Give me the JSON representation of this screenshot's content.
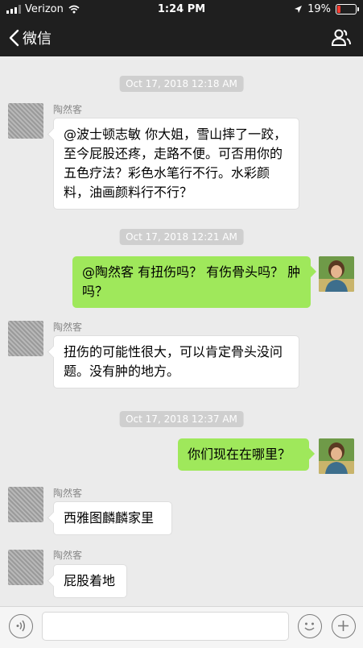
{
  "status": {
    "carrier": "Verizon",
    "time": "1:24 PM",
    "battery": "19%",
    "battery_level": 0.19
  },
  "nav": {
    "back_label": "微信"
  },
  "messages": {
    "ts1": "Oct 17, 2018 12:18 AM",
    "m1_name": "陶然客",
    "m1_text": "@波士顿志敏 你大姐，雪山摔了一跤，至今屁股还疼，走路不便。可否用你的五色疗法？彩色水笔行不行。水彩颜料，油画颜料行不行？",
    "ts2": "Oct 17, 2018 12:21 AM",
    "m2_text": "@陶然客 有扭伤吗？ 有伤骨头吗？ 肿吗？",
    "m3_name": "陶然客",
    "m3_text": "扭伤的可能性很大，可以肯定骨头没问题。没有肿的地方。",
    "ts3": "Oct 17, 2018 12:37 AM",
    "m4_text": "你们现在在哪里？",
    "m5_name": "陶然客",
    "m5_text": "西雅图麟麟家里",
    "m6_name": "陶然客",
    "m6_text": "屁股着地"
  },
  "icons": {
    "back": "chevron-left-icon",
    "contacts": "person-group-icon",
    "voice": "voice-icon",
    "emoji": "emoji-icon",
    "plus": "plus-icon"
  },
  "colors": {
    "bar": "#1f1f1f",
    "chat_bg": "#ebebeb",
    "out_bubble": "#9fe85b",
    "battery_low": "#ff3b30"
  }
}
